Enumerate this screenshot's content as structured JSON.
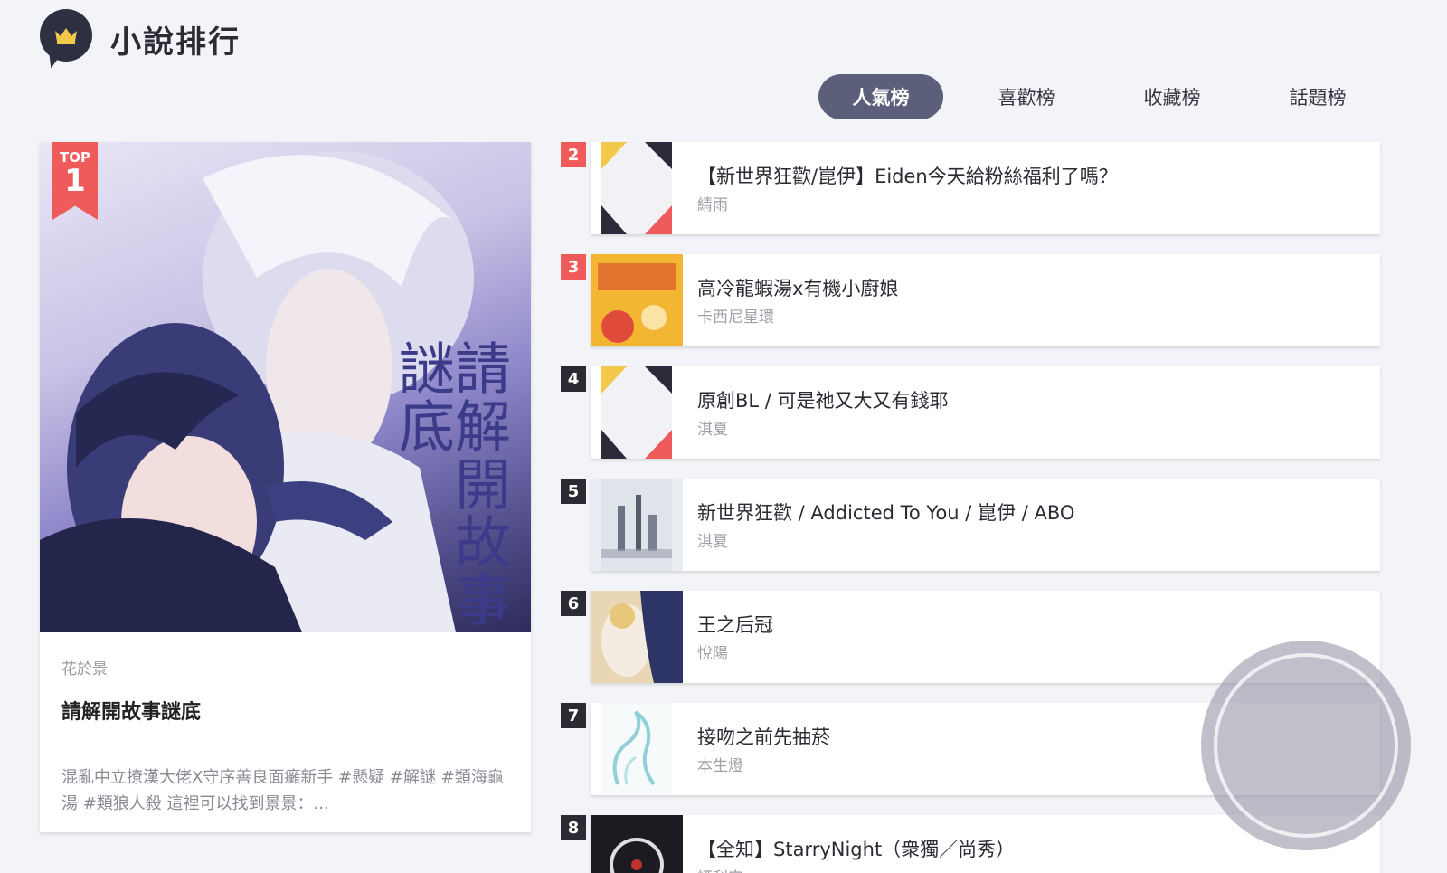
{
  "header": {
    "title": "小說排行",
    "logo_icon": "crown-icon"
  },
  "tabs": [
    {
      "label": "人氣榜",
      "active": true
    },
    {
      "label": "喜歡榜",
      "active": false
    },
    {
      "label": "收藏榜",
      "active": false
    },
    {
      "label": "話題榜",
      "active": false
    }
  ],
  "featured": {
    "badge_top": "TOP",
    "badge_rank": "1",
    "cover_title": "請解開故事謎底",
    "author": "花於景",
    "title": "請解開故事謎底",
    "description": "混亂中立撩漢大佬X守序善良面癱新手 #懸疑 #解謎 #類海龜湯 #類狼人殺 這裡可以找到景景：..."
  },
  "ranking": [
    {
      "rank": "2",
      "title": "【新世界狂歡/崑伊】Eiden今天給粉絲福利了嗎？",
      "author": "綪雨"
    },
    {
      "rank": "3",
      "title": "高冷龍蝦湯x有機小廚娘",
      "author": "卡西尼星環"
    },
    {
      "rank": "4",
      "title": "原創BL / 可是祂又大又有錢耶",
      "author": "淇夏"
    },
    {
      "rank": "5",
      "title": "新世界狂歡 / Addicted To You / 崑伊 / ABO",
      "author": "淇夏"
    },
    {
      "rank": "6",
      "title": "王之后冠",
      "author": "悅陽"
    },
    {
      "rank": "7",
      "title": "接吻之前先抽菸",
      "author": "本生燈"
    },
    {
      "rank": "8",
      "title": "【全知】StarryNight（衆獨／尚秀）",
      "author": "禋利安"
    }
  ],
  "colors": {
    "accent": "#5b5f7a",
    "rank_red": "#ef5a5a",
    "rank_dark": "#2b2b33",
    "background": "#f3f4f8"
  }
}
